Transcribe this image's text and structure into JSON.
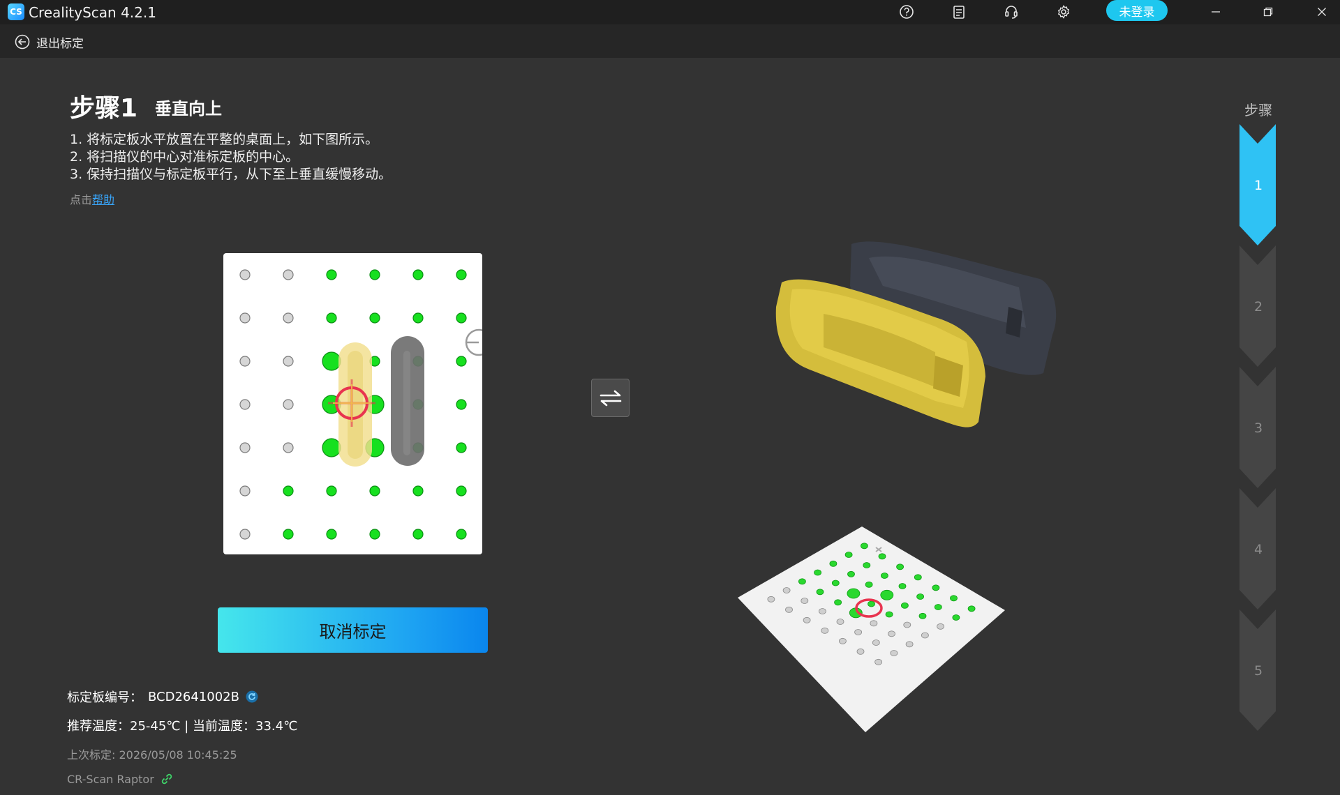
{
  "app": {
    "title": "CrealityScan 4.2.1",
    "login_label": "未登录",
    "accent_color": "#1ec7ef",
    "toolbar_icons": [
      "help-icon",
      "notes-icon",
      "support-headset-icon",
      "settings-gear-icon"
    ],
    "window_controls": [
      "minimize-icon",
      "restore-icon",
      "close-icon"
    ]
  },
  "subheader": {
    "back_label": "退出标定"
  },
  "step": {
    "title": "步骤1",
    "subtitle": "垂直向上",
    "instructions": [
      "1. 将标定板水平放置在平整的桌面上，如下图所示。",
      "2. 将扫描仪的中心对准标定板的中心。",
      "3. 保持扫描仪与标定板平行，从下至上垂直缓慢移动。"
    ],
    "help_prefix": "点击",
    "help_link": "帮助"
  },
  "swap_icon": "swap-arrows-icon",
  "cancel_button": "取消标定",
  "info": {
    "board_id_label": "标定板编号：",
    "board_id": "BCD2641002B",
    "temperature": "推荐温度：25-45℃ | 当前温度：33.4℃",
    "last_calibration": "上次标定: 2026/05/08 10:45:25",
    "device_name": "CR-Scan Raptor"
  },
  "steps_panel": {
    "label": "步骤",
    "items": [
      "1",
      "2",
      "3",
      "4",
      "5"
    ],
    "active_index": 0,
    "active_color": "#2fc2f4",
    "inactive_color": "#454545"
  }
}
